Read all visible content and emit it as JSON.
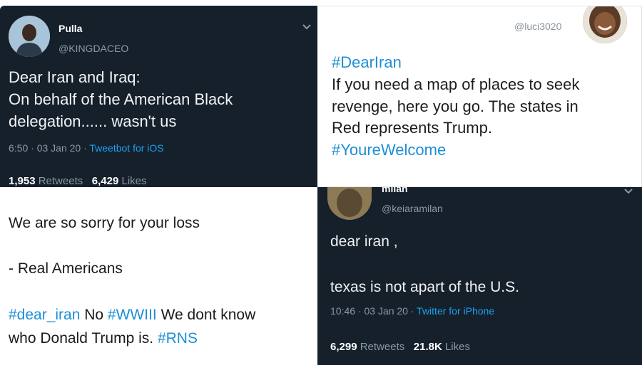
{
  "tweet1": {
    "name": "Pulla",
    "handle": "@KINGDACEO",
    "lines": [
      "Dear Iran and Iraq:",
      "On behalf of the American Black",
      "delegation...... wasn't us"
    ],
    "time": "6:50 · 03 Jan 20 · ",
    "source": "Tweetbot for iOS",
    "retweets_count": "1,953",
    "retweets_label": "Retweets",
    "likes_count": "6,429",
    "likes_label": "Likes"
  },
  "tweet2": {
    "handle": "@luci3020",
    "hashtag1": "#DearIran",
    "lines": [
      "If you need a map of places to seek",
      "revenge, here you go. The states in",
      "Red represents Trump."
    ],
    "hashtag2": "#YoureWelcome"
  },
  "tweet3": {
    "line1": "We are so sorry for your loss",
    "line2": "- Real Americans",
    "tag1": "#dear_iran",
    "text1": " No ",
    "tag2": "#WWIII",
    "text2": " We dont know",
    "text3": "who Donald Trump is. ",
    "tag3": "#RNS"
  },
  "tweet4": {
    "name": "milan",
    "handle": "@keiaramilan",
    "line1": "dear iran ,",
    "line2": "texas is not apart of the U.S.",
    "time": "10:46 · 03 Jan 20 · ",
    "source": "Twitter for iPhone",
    "retweets_count": "6,299",
    "retweets_label": "Retweets",
    "likes_count": "21.8K",
    "likes_label": "Likes"
  },
  "colors": {
    "dark_bg": "#15202b",
    "link": "#1da1f2",
    "muted": "#8899a6"
  },
  "icons": [
    "chevron-down-icon"
  ]
}
